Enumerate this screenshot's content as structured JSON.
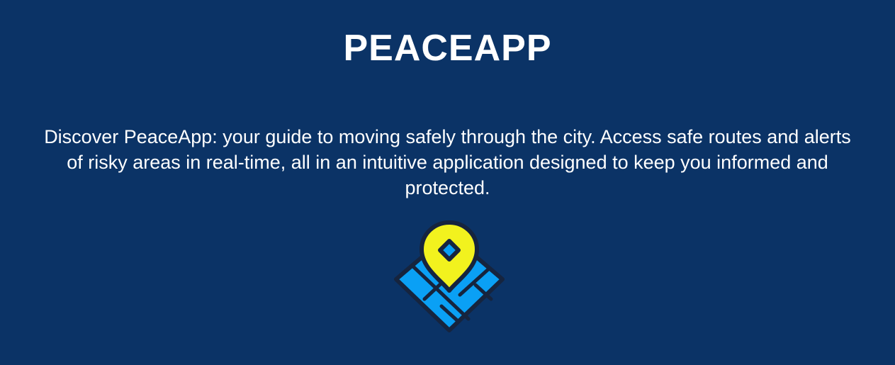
{
  "header": {
    "title": "PEACEAPP"
  },
  "main": {
    "description": "Discover PeaceApp: your guide to moving safely through the city. Access safe routes and alerts of risky areas in real-time, all in an intuitive application designed to keep you informed and protected.",
    "logo_icon": "map-pin-icon"
  },
  "colors": {
    "background": "#0b3366",
    "text": "#ffffff",
    "pin": "#f2f21e",
    "map": "#0aa0f5",
    "outline": "#16243e"
  }
}
